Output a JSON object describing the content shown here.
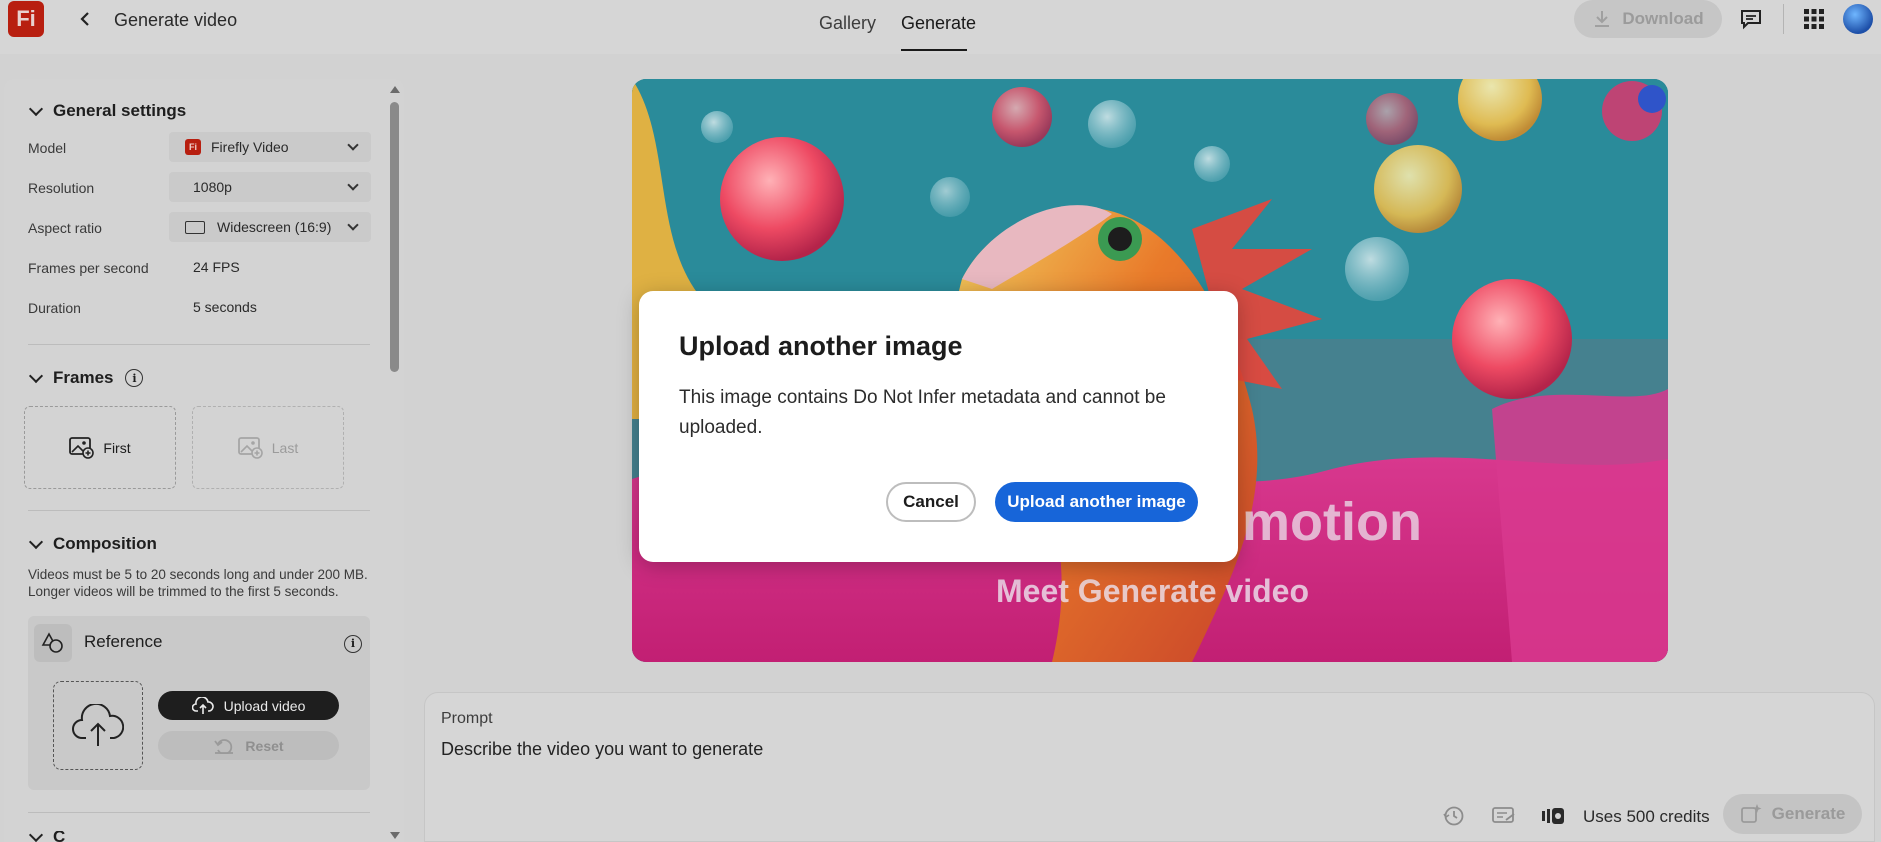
{
  "header": {
    "page_title": "Generate video",
    "tabs": [
      {
        "label": "Gallery",
        "active": false
      },
      {
        "label": "Generate",
        "active": true
      }
    ],
    "download_label": "Download",
    "icons": [
      "feedback-icon",
      "apps-grid-icon"
    ]
  },
  "app": {
    "logo_text": "Fi",
    "brand_color": "#b81f10"
  },
  "sidebar": {
    "general": {
      "title": "General settings",
      "rows": [
        {
          "label": "Model",
          "value": "Firefly Video"
        },
        {
          "label": "Resolution",
          "value": "1080p"
        },
        {
          "label": "Aspect ratio",
          "value": "Widescreen (16:9)"
        },
        {
          "label": "Frames per second",
          "value": "24 FPS"
        },
        {
          "label": "Duration",
          "value": "5 seconds"
        }
      ]
    },
    "frames": {
      "title": "Frames",
      "first_label": "First",
      "last_label": "Last"
    },
    "composition": {
      "title": "Composition",
      "description": "Videos must be 5 to 20 seconds long and under 200 MB. Longer videos will be trimmed to the first 5 seconds.",
      "reference_title": "Reference",
      "upload_video_label": "Upload video",
      "reset_label": "Reset"
    },
    "next_section_partial": "C"
  },
  "hero": {
    "headline_partial": "motion",
    "subheadline": "Meet Generate video"
  },
  "prompt": {
    "label": "Prompt",
    "placeholder": "Describe the video you want to generate",
    "credits_label": "Uses 500 credits",
    "generate_label": "Generate"
  },
  "dialog": {
    "title": "Upload another image",
    "body": "This image contains Do Not Infer metadata and cannot be uploaded.",
    "cancel_label": "Cancel",
    "confirm_label": "Upload another image",
    "accent_color": "#1765d9"
  }
}
